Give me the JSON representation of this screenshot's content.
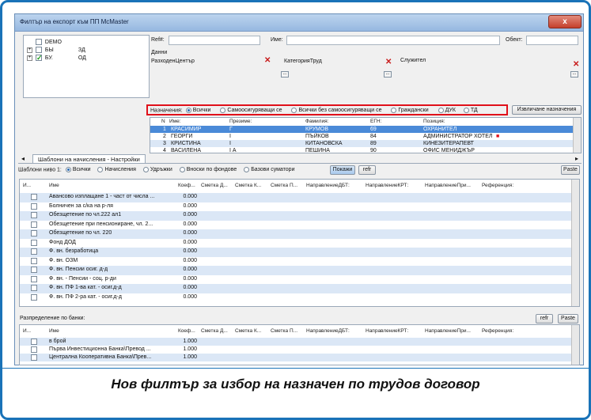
{
  "window": {
    "title": "Филтър на експорт към ПП McMaster",
    "close_label": "x"
  },
  "tree": {
    "items": [
      {
        "code": "DEMO",
        "name": "",
        "checked": false,
        "expand": ""
      },
      {
        "code": "БЫ",
        "name": "ЗД",
        "checked": false,
        "expand": "+"
      },
      {
        "code": "БУ.",
        "name": "ОД",
        "checked": true,
        "expand": "+"
      }
    ]
  },
  "filters": {
    "refn_label": "Ref#:",
    "name_label": "Име:",
    "object_label": "Обект:",
    "data_label": "Данни",
    "cost_center_label": "РазходенЦентър",
    "category_label": "КатегорияТруд",
    "employee_label": "Служител",
    "dots": "..."
  },
  "assignments": {
    "label": "Назначения:",
    "options": [
      {
        "label": "Всички",
        "on": true
      },
      {
        "label": "Самоосигуряващи се",
        "on": false
      },
      {
        "label": "Всички без самоосигуряващи се",
        "on": false
      },
      {
        "label": "Граждански",
        "on": false
      },
      {
        "label": "ДУК",
        "on": false
      },
      {
        "label": "ТД",
        "on": false
      }
    ],
    "extract_button": "Извличане назначения"
  },
  "employees": {
    "columns": [
      "N",
      "Име:",
      "Презиме:",
      "Фамилия:",
      "ЕГН:",
      "Позиция:"
    ],
    "rows": [
      {
        "n": "1",
        "name": "КРАСИМИР",
        "mid": "Г",
        "last": "КРУМОВ",
        "egn": "69",
        "pos": "ОХРАНИТЕЛ",
        "style": "sel"
      },
      {
        "n": "2",
        "name": "ГЕОРГИ",
        "mid": "І",
        "last": "ПЪЙКОВ",
        "egn": "84",
        "pos": "АДМИНИСТРАТОР ХОТЕЛ",
        "style": "norm"
      },
      {
        "n": "3",
        "name": "КРИСТИНА",
        "mid": "І",
        "last": "КИТАНОВСКА",
        "egn": "89",
        "pos": "КИНЕЗИТЕРАПЕВТ",
        "style": "alt"
      },
      {
        "n": "4",
        "name": "ВАСИЛЕНА",
        "mid": "І        А",
        "last": "ПЕШИНА",
        "egn": "90",
        "pos": "ОФИС МЕНИДЖЪР",
        "style": "norm"
      }
    ]
  },
  "templates": {
    "tab_label": "Шаблони на начисления - Настройки",
    "level_label": "Шаблони ниво 1:",
    "radios": [
      {
        "label": "Всички",
        "on": true
      },
      {
        "label": "Начисления",
        "on": false
      },
      {
        "label": "Удръжки",
        "on": false
      },
      {
        "label": "Вноски по фондове",
        "on": false
      },
      {
        "label": "Базови суматори",
        "on": false
      }
    ],
    "show_button": "Покажи",
    "refr_button": "refr",
    "paste_button": "Paste",
    "columns": [
      "И...",
      "Име",
      "Коеф...",
      "Сметка Д...",
      "Сметка К...",
      "Сметка П...",
      "НаправлениеДБТ:",
      "НаправлениеКРТ:",
      "НаправлениеПри...",
      "Референция:"
    ],
    "rows": [
      {
        "name": "Авансово изплащане 1 - част от числа ...",
        "coef": "0.000",
        "style": "alt"
      },
      {
        "name": "Болничен за с/ка на р-ля",
        "coef": "0.000",
        "style": "norm"
      },
      {
        "name": "Обезщетение по чл.222 ал1",
        "coef": "0.000",
        "style": "alt"
      },
      {
        "name": "Обезщетение при пенсиониране, чл. 2...",
        "coef": "0.000",
        "style": "norm"
      },
      {
        "name": "Обезщетение по чл. 220",
        "coef": "0.000",
        "style": "alt"
      },
      {
        "name": "Фонд ДОД",
        "coef": "0.000",
        "style": "norm"
      },
      {
        "name": "Ф. вн. безработица",
        "coef": "0.000",
        "style": "alt"
      },
      {
        "name": "Ф. вн. ОЗМ",
        "coef": "0.000",
        "style": "norm"
      },
      {
        "name": "Ф. вн. Пенсии осиг. д-д",
        "coef": "0.000",
        "style": "alt"
      },
      {
        "name": "Ф. вн. - Пенсии - соц. р-ди",
        "coef": "0.000",
        "style": "norm"
      },
      {
        "name": "Ф. вн. ПФ 1-ва кат. - осиг.д-д",
        "coef": "0.000",
        "style": "alt"
      },
      {
        "name": "Ф. вн. ПФ 2-ра кат. - осиг.д-д",
        "coef": "0.000",
        "style": "norm"
      }
    ]
  },
  "banks": {
    "label": "Разпределение по банки:",
    "refr_button": "refr",
    "paste_button": "Paste",
    "columns": [
      "И...",
      "Име",
      "Коеф...",
      "Сметка Д...",
      "Сметка К...",
      "Сметка П...",
      "НаправлениеДБТ:",
      "НаправлениеКРТ:",
      "НаправлениеПри...",
      "Референция:"
    ],
    "rows": [
      {
        "name": "в брой",
        "coef": "1.000",
        "style": "alt"
      },
      {
        "name": "Първа Инвестиционна Банка\\Превод ...",
        "coef": "1.000",
        "style": "norm"
      },
      {
        "name": "Централна Кооперативна Банка\\Прев...",
        "coef": "1.000",
        "style": "alt"
      }
    ]
  },
  "caption": "Нов филтър за избор на назначен по трудов договор"
}
